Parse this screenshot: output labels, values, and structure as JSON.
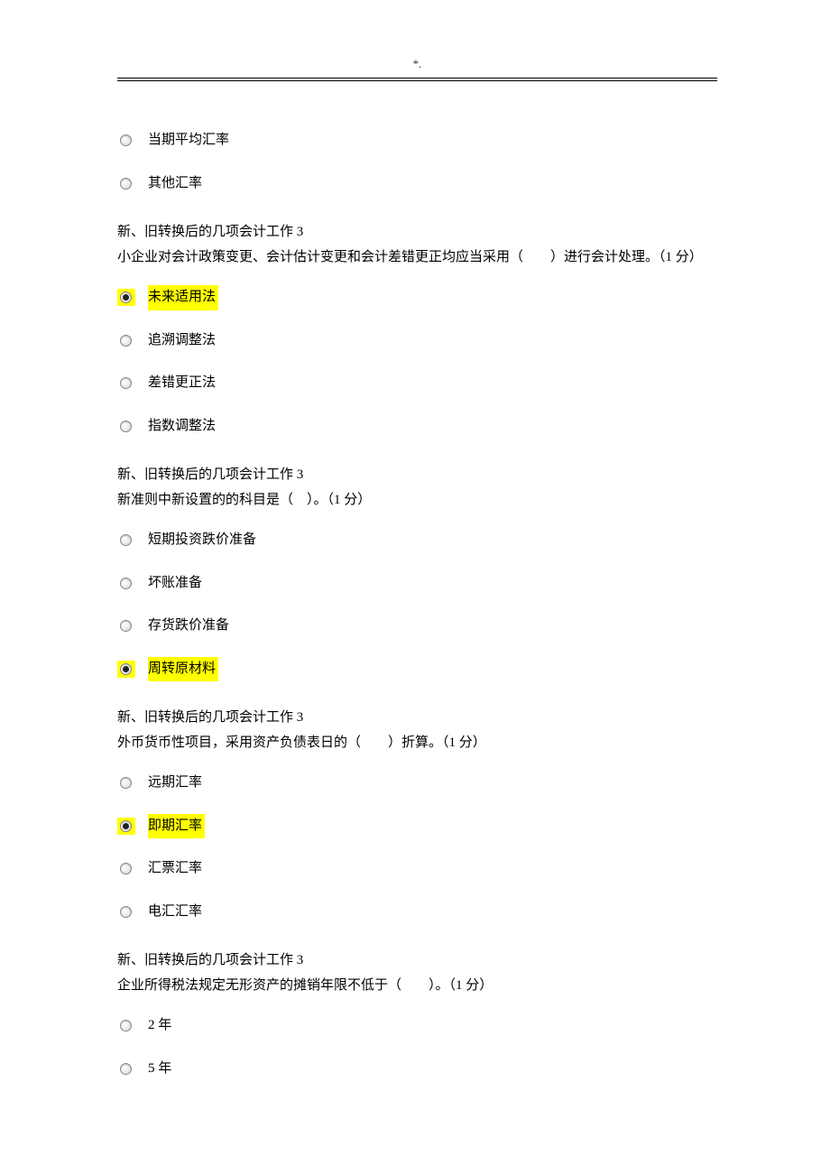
{
  "header": "*.",
  "orphan_options": [
    {
      "label": "当期平均汇率",
      "selected": false,
      "highlighted": false
    },
    {
      "label": "其他汇率",
      "selected": false,
      "highlighted": false
    }
  ],
  "questions": [
    {
      "title": "新、旧转换后的几项会计工作 3",
      "text": "小企业对会计政策变更、会计估计变更和会计差错更正均应当采用（　　）进行会计处理。（1 分）",
      "options": [
        {
          "label": "未来适用法",
          "selected": true,
          "highlighted": true
        },
        {
          "label": "追溯调整法",
          "selected": false,
          "highlighted": false
        },
        {
          "label": "差错更正法",
          "selected": false,
          "highlighted": false
        },
        {
          "label": "指数调整法",
          "selected": false,
          "highlighted": false
        }
      ]
    },
    {
      "title": "新、旧转换后的几项会计工作 3",
      "text": "新准则中新设置的的科目是（　）。（1 分）",
      "options": [
        {
          "label": "短期投资跌价准备",
          "selected": false,
          "highlighted": false
        },
        {
          "label": "坏账准备",
          "selected": false,
          "highlighted": false
        },
        {
          "label": "存货跌价准备",
          "selected": false,
          "highlighted": false
        },
        {
          "label": "周转原材料",
          "selected": true,
          "highlighted": true
        }
      ]
    },
    {
      "title": "新、旧转换后的几项会计工作 3",
      "text": "外币货币性项目，采用资产负债表日的（　　）折算。（1 分）",
      "options": [
        {
          "label": "远期汇率",
          "selected": false,
          "highlighted": false
        },
        {
          "label": "即期汇率",
          "selected": true,
          "highlighted": true
        },
        {
          "label": "汇票汇率",
          "selected": false,
          "highlighted": false
        },
        {
          "label": "电汇汇率",
          "selected": false,
          "highlighted": false
        }
      ]
    },
    {
      "title": "新、旧转换后的几项会计工作 3",
      "text": "企业所得税法规定无形资产的摊销年限不低于（　　）。（1 分）",
      "options": [
        {
          "label": "2 年",
          "selected": false,
          "highlighted": false
        },
        {
          "label": "5 年",
          "selected": false,
          "highlighted": false
        }
      ]
    }
  ]
}
